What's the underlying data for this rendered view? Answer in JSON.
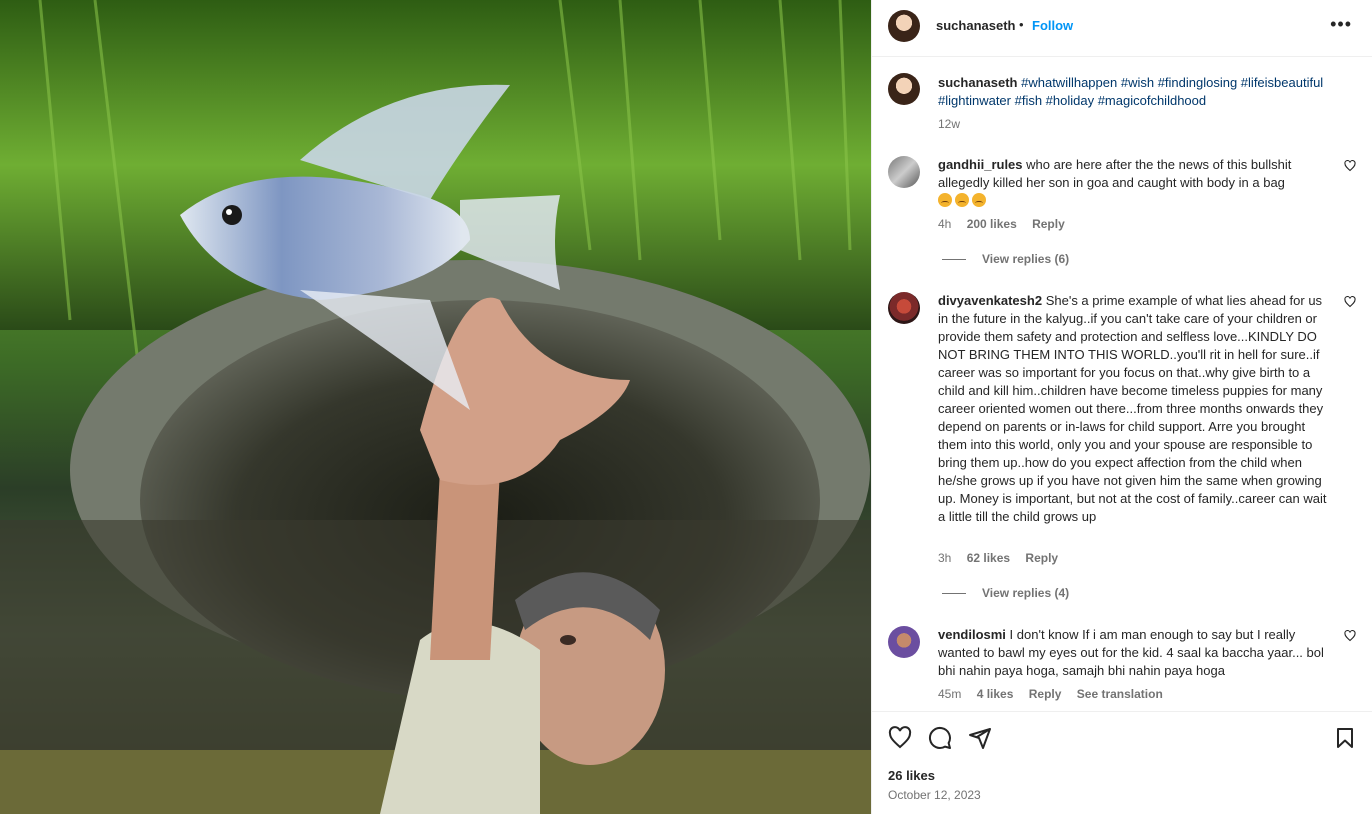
{
  "post": {
    "username": "suchanaseth",
    "follow_label": "Follow",
    "separator": "•",
    "more_label": "•••"
  },
  "caption": {
    "username": "suchanaseth",
    "hashtags": "#whatwillhappen #wish #findinglosing #lifeisbeautiful #lightinwater #fish #holiday #magicofchildhood",
    "time": "12w"
  },
  "comments": [
    {
      "username": "gandhii_rules",
      "text": "who are here after the the news of this bullshit allegedly killed her son in goa and caught with body in a bag",
      "time": "4h",
      "likes": "200 likes",
      "reply_label": "Reply",
      "view_replies": "View replies (6)"
    },
    {
      "username": "divyavenkatesh2",
      "text": "She's a prime example of what lies ahead for us in the future in the kalyug..if you can't take care of your children or provide them safety and protection and selfless love...KINDLY DO NOT BRING THEM INTO THIS WORLD..you'll rit in hell for sure..if career was so important for you focus on that..why give birth to a child and kill him..children have become timeless puppies for many career oriented women out there...from three months onwards they depend on parents or in-laws for child support. Arre you brought them into this world, only you and your spouse are responsible to bring them up..how do you expect affection from the child when he/she grows up if you have not given him the same when growing up. Money is important, but not at the cost of family..career can wait a little till the child grows up",
      "time": "3h",
      "likes": "62 likes",
      "reply_label": "Reply",
      "view_replies": "View replies (4)"
    },
    {
      "username": "vendilosmi",
      "text": "I don't know If i am man enough to say but I really wanted to bawl my eyes out for the kid. 4 saal ka baccha yaar... bol bhi nahin paya hoga, samajh bhi nahin paya hoga",
      "time": "45m",
      "likes": "4 likes",
      "reply_label": "Reply",
      "translation_label": "See translation"
    }
  ],
  "footer": {
    "likes": "26 likes",
    "date": "October 12, 2023"
  },
  "icons": {
    "like": "heart-icon",
    "comment": "comment-icon",
    "share": "send-icon",
    "save": "bookmark-icon",
    "comment_like": "heart-icon"
  },
  "colors": {
    "link": "#0095f6",
    "hashtag": "#00376b",
    "muted": "#737373"
  }
}
